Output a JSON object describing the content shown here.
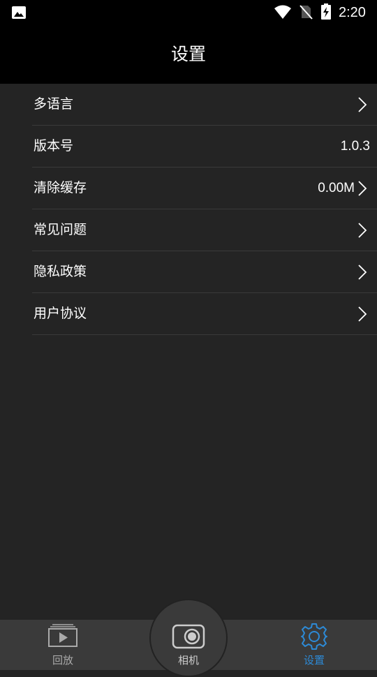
{
  "status_bar": {
    "time": "2:20",
    "icons": [
      "image-notification-icon",
      "wifi-icon",
      "no-sim-icon",
      "battery-charging-icon"
    ]
  },
  "header": {
    "title": "设置"
  },
  "settings": {
    "items": [
      {
        "label": "多语言",
        "value": "",
        "chevron": true
      },
      {
        "label": "版本号",
        "value": "1.0.3",
        "chevron": false
      },
      {
        "label": "清除缓存",
        "value": "0.00M",
        "chevron": true
      },
      {
        "label": "常见问题",
        "value": "",
        "chevron": true
      },
      {
        "label": "隐私政策",
        "value": "",
        "chevron": true
      },
      {
        "label": "用户协议",
        "value": "",
        "chevron": true
      }
    ]
  },
  "bottom_nav": {
    "items": [
      {
        "label": "回放",
        "icon": "playback-icon",
        "active": false
      },
      {
        "label": "相机",
        "icon": "camera-icon",
        "active": false
      },
      {
        "label": "设置",
        "icon": "gear-icon",
        "active": true
      }
    ]
  },
  "colors": {
    "background": "#242424",
    "header": "#000000",
    "nav": "#3a3a3a",
    "accent": "#2d8ad6",
    "inactive": "#aaaaaa"
  }
}
